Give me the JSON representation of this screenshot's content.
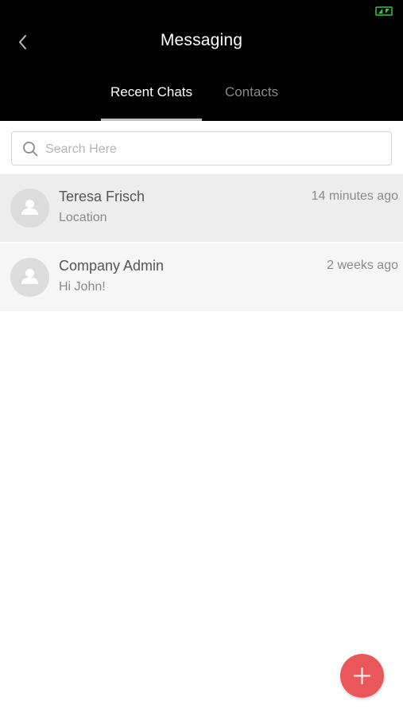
{
  "status_bar": {
    "icon": "battery-charging-icon",
    "icon_color": "#2ecc40"
  },
  "header": {
    "title": "Messaging",
    "back_icon": "chevron-left-icon",
    "background": "#000000"
  },
  "tabs": [
    {
      "label": "Recent Chats",
      "active": true
    },
    {
      "label": "Contacts",
      "active": false
    }
  ],
  "search": {
    "placeholder": "Search Here",
    "value": "",
    "icon": "search-icon"
  },
  "chats": [
    {
      "name": "Teresa Frisch",
      "preview": "Location",
      "time": "14 minutes ago",
      "avatar_icon": "user-placeholder-icon",
      "selected": true
    },
    {
      "name": "Company Admin",
      "preview": "Hi John!",
      "time": "2 weeks ago",
      "avatar_icon": "user-placeholder-icon",
      "selected": false
    }
  ],
  "fab": {
    "icon": "plus-icon",
    "color": "#e9575a"
  }
}
